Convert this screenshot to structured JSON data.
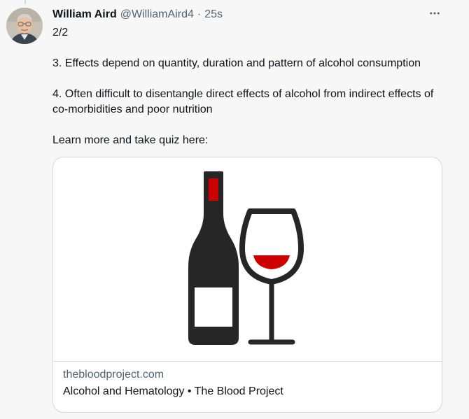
{
  "tweet": {
    "author_name": "William Aird",
    "author_handle": "@WilliamAird4",
    "separator": "·",
    "timestamp": "25s",
    "lines": [
      "2/2",
      "3. Effects depend on quantity, duration and pattern of alcohol consumption",
      "4. Often difficult to disentangle direct effects of alcohol from indirect effects of co-morbidities and poor nutrition",
      "Learn more and take quiz here:"
    ]
  },
  "link_card": {
    "domain": "thebloodproject.com",
    "title": "Alcohol and Hematology • The Blood Project",
    "image_icons": [
      "wine-bottle-icon",
      "wine-glass-icon"
    ]
  },
  "icons": {
    "more": "more-options-icon"
  },
  "colors": {
    "wine_red": "#cc0000",
    "icon_dark": "#262626",
    "muted_text": "#536471",
    "border": "#cfd9de"
  }
}
